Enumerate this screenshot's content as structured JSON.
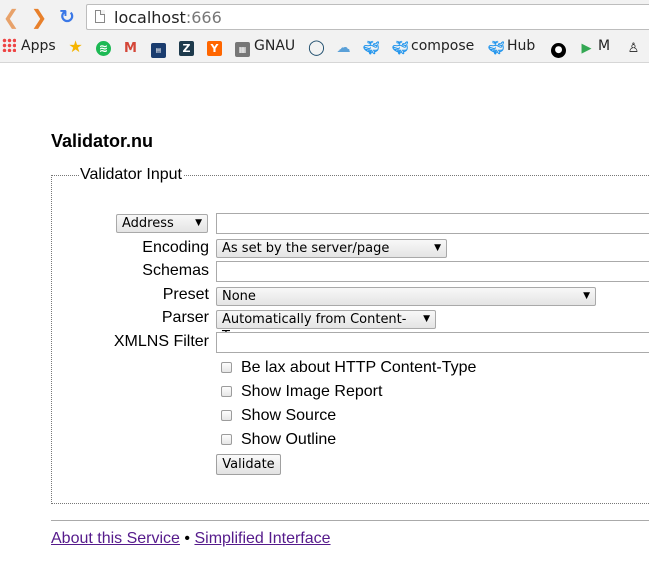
{
  "browser": {
    "url_host": "localhost",
    "url_port": ":666",
    "bookmarks": [
      {
        "label": "Apps",
        "icon": "apps-grid-icon"
      },
      {
        "label": "",
        "icon": "star-icon"
      },
      {
        "label": "",
        "icon": "spotify-icon"
      },
      {
        "label": "",
        "icon": "gmail-icon"
      },
      {
        "label": "",
        "icon": "news-icon"
      },
      {
        "label": "",
        "icon": "zendesk-icon"
      },
      {
        "label": "",
        "icon": "ycombinator-icon"
      },
      {
        "label": "GNAU",
        "icon": "gnau-icon"
      },
      {
        "label": "",
        "icon": "chat-icon"
      },
      {
        "label": "",
        "icon": "cloud-icon"
      },
      {
        "label": "",
        "icon": "docker-icon"
      },
      {
        "label": "compose",
        "icon": "docker-icon"
      },
      {
        "label": "Hub",
        "icon": "docker-icon"
      },
      {
        "label": "",
        "icon": "github-icon"
      },
      {
        "label": "M",
        "icon": "play-store-icon"
      },
      {
        "label": "",
        "icon": "linux-icon"
      }
    ]
  },
  "page": {
    "title": "Validator.nu",
    "legend": "Validator Input",
    "address_select": "Address",
    "labels": {
      "encoding": "Encoding",
      "schemas": "Schemas",
      "preset": "Preset",
      "parser": "Parser",
      "xmlns": "XMLNS Filter"
    },
    "encoding_value": "As set by the server/page",
    "preset_value": "None",
    "parser_value": "Automatically from Content-Type",
    "checkboxes": [
      "Be lax about HTTP Content-Type",
      "Show Image Report",
      "Show Source",
      "Show Outline"
    ],
    "validate_label": "Validate",
    "footer": {
      "about": "About this Service",
      "separator": "•",
      "simplified": "Simplified Interface"
    }
  }
}
